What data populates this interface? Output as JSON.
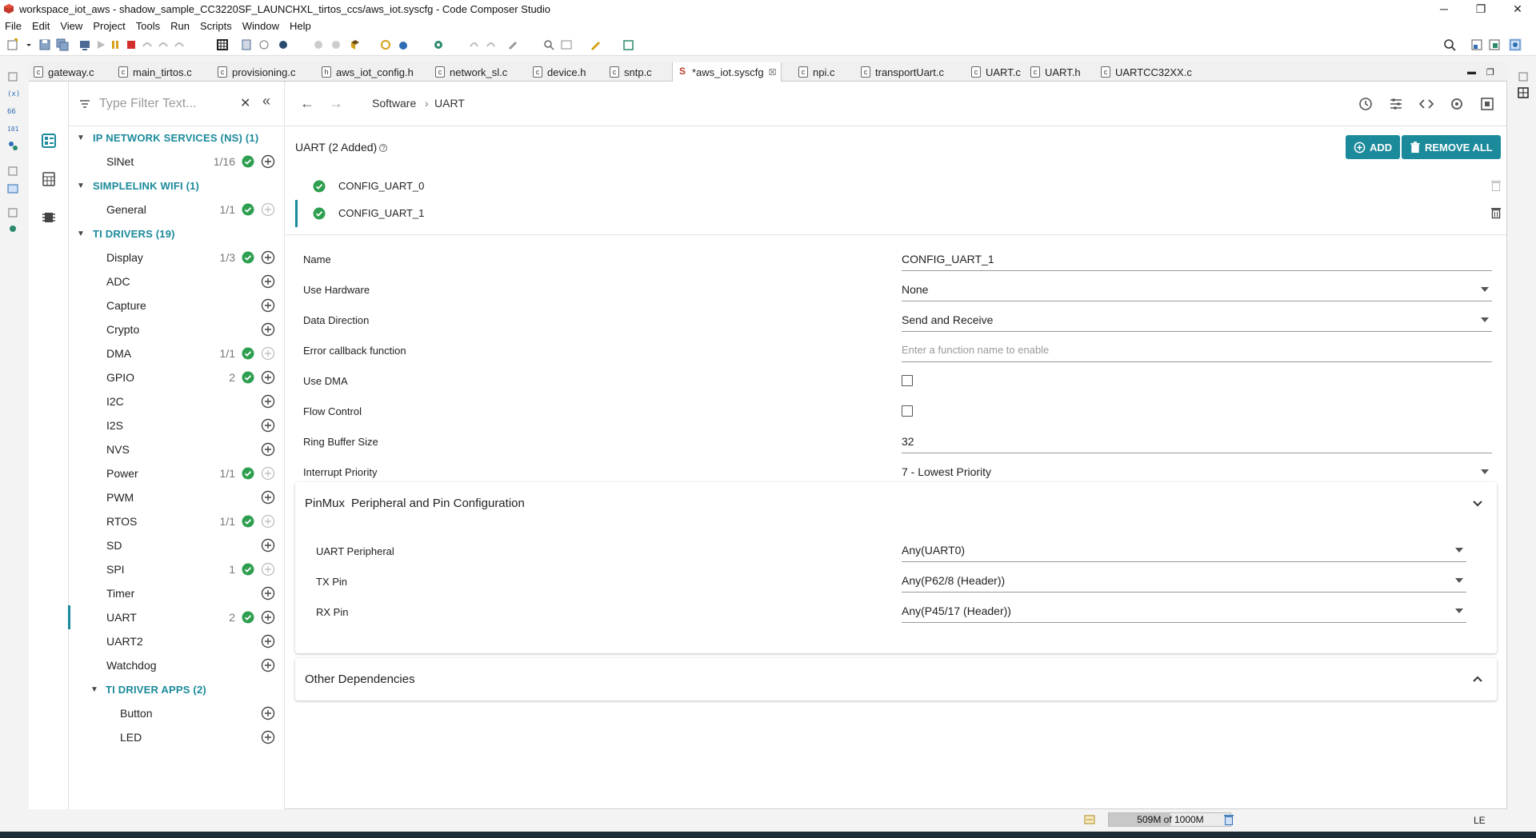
{
  "window": {
    "title": "workspace_iot_aws - shadow_sample_CC3220SF_LAUNCHXL_tirtos_ccs/aws_iot.syscfg - Code Composer Studio",
    "minimize": "─",
    "maximize": "❐",
    "close": "✕"
  },
  "menu": [
    "File",
    "Edit",
    "View",
    "Project",
    "Tools",
    "Run",
    "Scripts",
    "Window",
    "Help"
  ],
  "tabs": [
    {
      "label": "gateway.c",
      "icon": "c-file-icon",
      "glyph": "c"
    },
    {
      "label": "main_tirtos.c",
      "icon": "c-file-icon",
      "glyph": "c"
    },
    {
      "label": "provisioning.c",
      "icon": "c-file-icon",
      "glyph": "c"
    },
    {
      "label": "aws_iot_config.h",
      "icon": "h-file-icon",
      "glyph": "h"
    },
    {
      "label": "network_sl.c",
      "icon": "c-file-icon",
      "glyph": "c"
    },
    {
      "label": "device.h",
      "icon": "h-file-icon",
      "glyph": "c"
    },
    {
      "label": "sntp.c",
      "icon": "c-file-icon",
      "glyph": "c"
    },
    {
      "label": "*aws_iot.syscfg",
      "icon": "syscfg-file-icon",
      "glyph": "S",
      "active": true,
      "close": "☒"
    },
    {
      "label": "npi.c",
      "icon": "c-file-icon",
      "glyph": "c"
    },
    {
      "label": "transportUart.c",
      "icon": "c-file-icon",
      "glyph": "c"
    },
    {
      "label": "UART.c",
      "icon": "c-file-icon",
      "glyph": "c"
    },
    {
      "label": "UART.h",
      "icon": "h-file-icon",
      "glyph": "c"
    },
    {
      "label": "UARTCC32XX.c",
      "icon": "c-file-icon",
      "glyph": "c"
    }
  ],
  "tree": {
    "filter_placeholder": "Type Filter Text...",
    "categories": [
      {
        "label": "IP NETWORK SERVICES (NS) (1)",
        "items": [
          {
            "label": "SlNet",
            "count": "1/16",
            "checked": true,
            "add_enabled": true
          }
        ]
      },
      {
        "label": "SIMPLELINK WIFI (1)",
        "items": [
          {
            "label": "General",
            "count": "1/1",
            "checked": true,
            "add_enabled": false
          }
        ]
      },
      {
        "label": "TI DRIVERS (19)",
        "items": [
          {
            "label": "Display",
            "count": "1/3",
            "checked": true,
            "add_enabled": true
          },
          {
            "label": "ADC",
            "count": "",
            "checked": false,
            "add_enabled": true
          },
          {
            "label": "Capture",
            "count": "",
            "checked": false,
            "add_enabled": true
          },
          {
            "label": "Crypto",
            "count": "",
            "checked": false,
            "add_enabled": true
          },
          {
            "label": "DMA",
            "count": "1/1",
            "checked": true,
            "add_enabled": false
          },
          {
            "label": "GPIO",
            "count": "2",
            "checked": true,
            "add_enabled": true
          },
          {
            "label": "I2C",
            "count": "",
            "checked": false,
            "add_enabled": true
          },
          {
            "label": "I2S",
            "count": "",
            "checked": false,
            "add_enabled": true
          },
          {
            "label": "NVS",
            "count": "",
            "checked": false,
            "add_enabled": true
          },
          {
            "label": "Power",
            "count": "1/1",
            "checked": true,
            "add_enabled": false
          },
          {
            "label": "PWM",
            "count": "",
            "checked": false,
            "add_enabled": true
          },
          {
            "label": "RTOS",
            "count": "1/1",
            "checked": true,
            "add_enabled": false
          },
          {
            "label": "SD",
            "count": "",
            "checked": false,
            "add_enabled": true
          },
          {
            "label": "SPI",
            "count": "1",
            "checked": true,
            "add_enabled": false
          },
          {
            "label": "Timer",
            "count": "",
            "checked": false,
            "add_enabled": true
          },
          {
            "label": "UART",
            "count": "2",
            "checked": true,
            "add_enabled": true,
            "selected": true
          },
          {
            "label": "UART2",
            "count": "",
            "checked": false,
            "add_enabled": true
          },
          {
            "label": "Watchdog",
            "count": "",
            "checked": false,
            "add_enabled": true
          }
        ]
      },
      {
        "label": "TI DRIVER APPS (2)",
        "sub": true,
        "items": [
          {
            "label": "Button",
            "count": "",
            "checked": false,
            "add_enabled": true
          },
          {
            "label": "LED",
            "count": "",
            "checked": false,
            "add_enabled": true
          }
        ]
      }
    ]
  },
  "breadcrumb": {
    "root": "Software",
    "sep": "›",
    "current": "UART"
  },
  "module": {
    "title": "UART (2 Added)",
    "help": "?",
    "add_label": "ADD",
    "remove_all_label": "REMOVE ALL",
    "instances": [
      {
        "name": "CONFIG_UART_0",
        "selected": false
      },
      {
        "name": "CONFIG_UART_1",
        "selected": true
      }
    ]
  },
  "config": [
    {
      "label": "Name",
      "value": "CONFIG_UART_1",
      "type": "text"
    },
    {
      "label": "Use Hardware",
      "value": "None",
      "type": "select"
    },
    {
      "label": "Data Direction",
      "value": "Send and Receive",
      "type": "select"
    },
    {
      "label": "Error callback function",
      "value": "",
      "placeholder": "Enter a function name to enable",
      "type": "text"
    },
    {
      "label": "Use DMA",
      "value": false,
      "type": "checkbox"
    },
    {
      "label": "Flow Control",
      "value": false,
      "type": "checkbox"
    },
    {
      "label": "Ring Buffer Size",
      "value": "32",
      "type": "text"
    },
    {
      "label": "Interrupt Priority",
      "value": "7 - Lowest Priority",
      "type": "select"
    }
  ],
  "pinmux": {
    "title": "PinMux",
    "subtitle": "Peripheral and Pin Configuration",
    "rows": [
      {
        "label": "UART Peripheral",
        "value": "Any(UART0)"
      },
      {
        "label": "TX Pin",
        "value": "Any(P62/8 (Header))"
      },
      {
        "label": "RX Pin",
        "value": "Any(P45/17 (Header))"
      }
    ]
  },
  "other_deps": {
    "title": "Other Dependencies"
  },
  "status": {
    "heap_text": "509M of 1000M",
    "heap_fraction": 0.509,
    "encoding": "LE"
  },
  "colors": {
    "accent": "#1b8a9b",
    "check": "#2e9e4f"
  }
}
